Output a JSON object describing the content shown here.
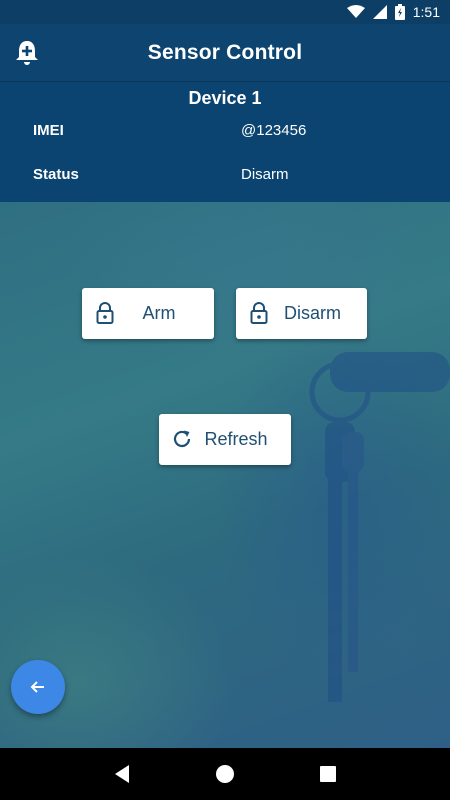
{
  "status_bar": {
    "time": "1:51",
    "icons": [
      "wifi-icon",
      "signal-icon",
      "battery-charging-icon"
    ]
  },
  "app_bar": {
    "title": "Sensor Control",
    "left_icon": "bell-plus-icon"
  },
  "device": {
    "title": "Device 1",
    "rows": [
      {
        "label": "IMEI",
        "value": "@123456"
      },
      {
        "label": "Status",
        "value": "Disarm"
      }
    ]
  },
  "actions": {
    "arm_label": "Arm",
    "disarm_label": "Disarm",
    "refresh_label": "Refresh",
    "arm_icon": "lock-icon",
    "disarm_icon": "lock-icon",
    "refresh_icon": "refresh-icon"
  },
  "fab": {
    "icon": "arrow-left-icon"
  },
  "nav": {
    "icons": [
      "back-icon",
      "home-icon",
      "recents-icon"
    ]
  },
  "colors": {
    "primary": "#0d4470",
    "fab": "#3d87e6",
    "button_text": "#1f4f73"
  }
}
